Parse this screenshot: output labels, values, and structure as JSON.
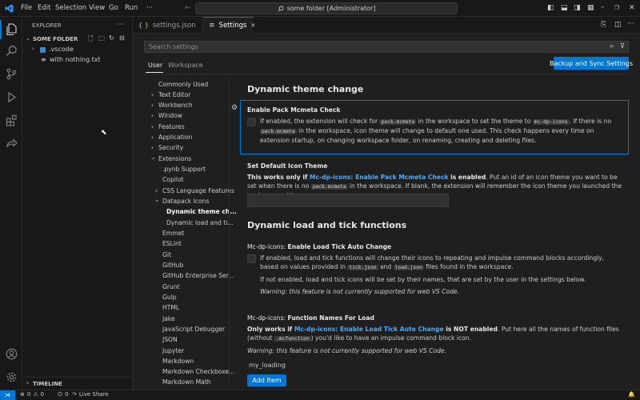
{
  "window": {
    "title": "some folder [Administrator]"
  },
  "menu": [
    "File",
    "Edit",
    "Selection",
    "View",
    "Go",
    "Run"
  ],
  "menu_more": "···",
  "explorer": {
    "header": "EXPLORER",
    "folder": "SOME FOLDER",
    "items": [
      ".vscode",
      "with nothing.txt"
    ],
    "timeline": "TIMELINE"
  },
  "tabs": [
    {
      "icon": "{ }",
      "label": "settings.json"
    },
    {
      "label": "Settings",
      "close": "✕"
    }
  ],
  "settings": {
    "search_placeholder": "Search settings",
    "scope_tabs": [
      "User",
      "Workspace"
    ],
    "backup_button": "Backup and Sync Settings",
    "toc": [
      "Commonly Used",
      "Text Editor",
      "Workbench",
      "Window",
      "Features",
      "Application",
      "Security",
      "Extensions",
      ".pynb Support",
      "Copilot",
      "CSS Language Features",
      "Datapack Icons",
      "Dynamic theme ch...",
      "Dynamic load and ti...",
      "Emmet",
      "ESLint",
      "Git",
      "GitHub",
      "GitHub Enterprise Ser...",
      "Grunt",
      "Gulp",
      "HTML",
      "Jake",
      "JavaScript Debugger",
      "JSON",
      "Jupyter",
      "Markdown",
      "Markdown Checkboxe...",
      "Markdown Math"
    ],
    "sections": {
      "dynamic_theme": {
        "title": "Dynamic theme change",
        "enable_pack": {
          "title": "Enable Pack Mcmeta Check",
          "d1": "If enabled, the extension will check for ",
          "c1": "pack.mcmeta",
          "d2": " in the workspace to set the theme to ",
          "c2": "mc-dp-icons",
          "d3": ". If there is no ",
          "c3": "pack.mcmeta",
          "d4": " in the workspace, icon theme will change to default one used. This check happens every time on extension startup, on changing workspace folder, on renaming, creating and deleting files."
        },
        "default_icon": {
          "title": "Set Default Icon Theme",
          "b1": "This works only if ",
          "link": "Mc-dp-icons: Enable Pack Mcmeta Check",
          "b2": " is enabled",
          "d1": ". Put an id of an icon theme you want to be set when there is no ",
          "c1": "pack.mcmeta",
          "d2": " in the workspace. If blank, the extension will remember the icon theme you launched the workspace with."
        }
      },
      "dynamic_load": {
        "title": "Dynamic load and tick functions",
        "load_tick": {
          "prefix": "Mc-dp-icons: ",
          "title": "Enable Load Tick Auto Change",
          "d1": "If enabled, load and tick functions will change their icons to repeating and impulse command blocks accordingly, based on values provided in ",
          "c1": "tick.json",
          "d2": " and ",
          "c2": "load.json",
          "d3": " files found in the workspace.",
          "d4": "If not enabled, load and tick icons will be set by their names, that are set by the user in the settings below.",
          "warn": "Warning: this feature is not currently supported for web VS Code."
        },
        "func_names": {
          "prefix": "Mc-dp-icons: ",
          "title": "Function Names For Load",
          "b1": "Only works if ",
          "link": "Mc-dp-icons: Enable Load Tick Auto Change",
          "b2": " is NOT enabled",
          "d1": ". Put here all the names of function files (without ",
          "c1": ".mcfunction",
          "d2": ") you'd like to have an impulse command block icon.",
          "warn": "Warning: this feature is not currently supported for web VS Code.",
          "item": "my_loading",
          "add_button": "Add Item"
        }
      }
    }
  },
  "status": {
    "errors": "0",
    "warnings": "0",
    "ports": "0",
    "live_share": "Live Share"
  },
  "colors": {
    "accent": "#0078d4",
    "link": "#4daafc",
    "bg": "#1f1f1f",
    "panel": "#181818"
  }
}
